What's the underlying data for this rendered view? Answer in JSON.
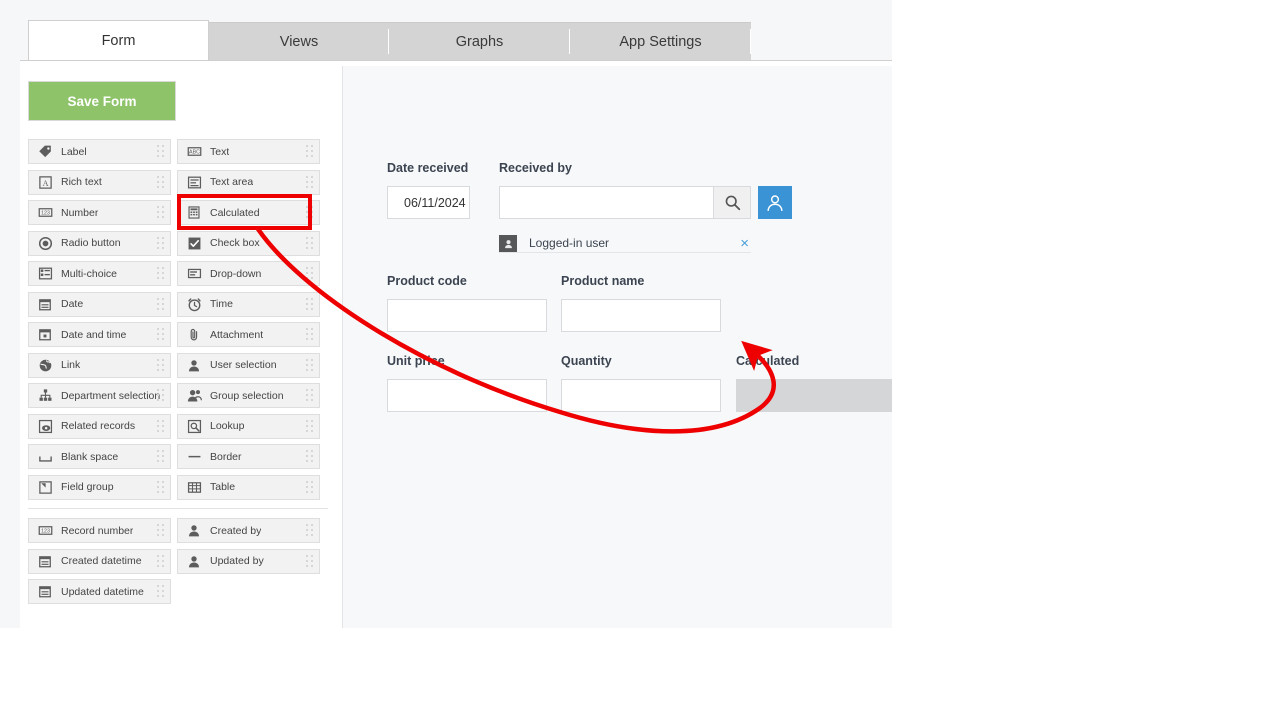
{
  "app": {
    "tabs": [
      {
        "label": "Form",
        "active": true
      },
      {
        "label": "Views",
        "active": false
      },
      {
        "label": "Graphs",
        "active": false
      },
      {
        "label": "App Settings",
        "active": false
      }
    ]
  },
  "sidebar": {
    "save_label": "Save Form",
    "palette_main": [
      [
        {
          "label": "Label",
          "icon": "tag-icon"
        },
        {
          "label": "Text",
          "icon": "abc-text-icon"
        }
      ],
      [
        {
          "label": "Rich text",
          "icon": "rich-text-icon"
        },
        {
          "label": "Text area",
          "icon": "text-area-icon"
        }
      ],
      [
        {
          "label": "Number",
          "icon": "number-123-icon"
        },
        {
          "label": "Calculated",
          "icon": "calculator-icon"
        }
      ],
      [
        {
          "label": "Radio button",
          "icon": "radio-button-icon"
        },
        {
          "label": "Check box",
          "icon": "check-box-icon"
        }
      ],
      [
        {
          "label": "Multi-choice",
          "icon": "multi-choice-icon"
        },
        {
          "label": "Drop-down",
          "icon": "drop-down-icon"
        }
      ],
      [
        {
          "label": "Date",
          "icon": "calendar-icon"
        },
        {
          "label": "Time",
          "icon": "clock-icon"
        }
      ],
      [
        {
          "label": "Date and time",
          "icon": "date-time-icon"
        },
        {
          "label": "Attachment",
          "icon": "paperclip-icon"
        }
      ],
      [
        {
          "label": "Link",
          "icon": "globe-icon"
        },
        {
          "label": "User selection",
          "icon": "user-icon"
        }
      ],
      [
        {
          "label": "Department selection",
          "icon": "org-tree-icon"
        },
        {
          "label": "Group selection",
          "icon": "users-group-icon"
        }
      ],
      [
        {
          "label": "Related records",
          "icon": "related-records-icon"
        },
        {
          "label": "Lookup",
          "icon": "lookup-magnifier-icon"
        }
      ],
      [
        {
          "label": "Blank space",
          "icon": "blank-space-icon"
        },
        {
          "label": "Border",
          "icon": "border-line-icon"
        }
      ],
      [
        {
          "label": "Field group",
          "icon": "field-group-icon"
        },
        {
          "label": "Table",
          "icon": "table-grid-icon"
        }
      ]
    ],
    "palette_system": [
      [
        {
          "label": "Record number",
          "icon": "number-123-icon"
        },
        {
          "label": "Created by",
          "icon": "user-icon"
        }
      ],
      [
        {
          "label": "Created datetime",
          "icon": "calendar-icon"
        },
        {
          "label": "Updated by",
          "icon": "user-icon"
        }
      ],
      [
        {
          "label": "Updated datetime",
          "icon": "calendar-icon"
        },
        {
          "label": "",
          "icon": ""
        }
      ]
    ],
    "highlighted_item": "Calculated"
  },
  "form": {
    "fields": [
      {
        "name": "date-received",
        "label": "Date received",
        "value": "06/11/2024",
        "type": "date"
      },
      {
        "name": "received-by",
        "label": "Received by",
        "value": "",
        "type": "user-selection"
      },
      {
        "name": "product-code",
        "label": "Product code",
        "value": "",
        "type": "text"
      },
      {
        "name": "product-name",
        "label": "Product name",
        "value": "",
        "type": "text"
      },
      {
        "name": "unit-price",
        "label": "Unit price",
        "value": "",
        "type": "number"
      },
      {
        "name": "quantity",
        "label": "Quantity",
        "value": "",
        "type": "number"
      },
      {
        "name": "calculated",
        "label": "Calculated",
        "value": "",
        "type": "calculated"
      }
    ],
    "received_by_chip": {
      "name": "Logged-in user",
      "remove_label": "×"
    },
    "search_icon": "search-icon",
    "user_picker_icon": "user-picker-icon"
  },
  "annotation": {
    "color": "#ee0000",
    "highlight_target": "Calculated",
    "arrow_target": "calculated-field"
  },
  "colors": {
    "accent_blue": "#3a93d4",
    "save_green": "#8ec36a",
    "annotation_red": "#ee0000",
    "readonly_gray": "#d4d6d8",
    "tab_inactive": "#d4d4d4"
  }
}
